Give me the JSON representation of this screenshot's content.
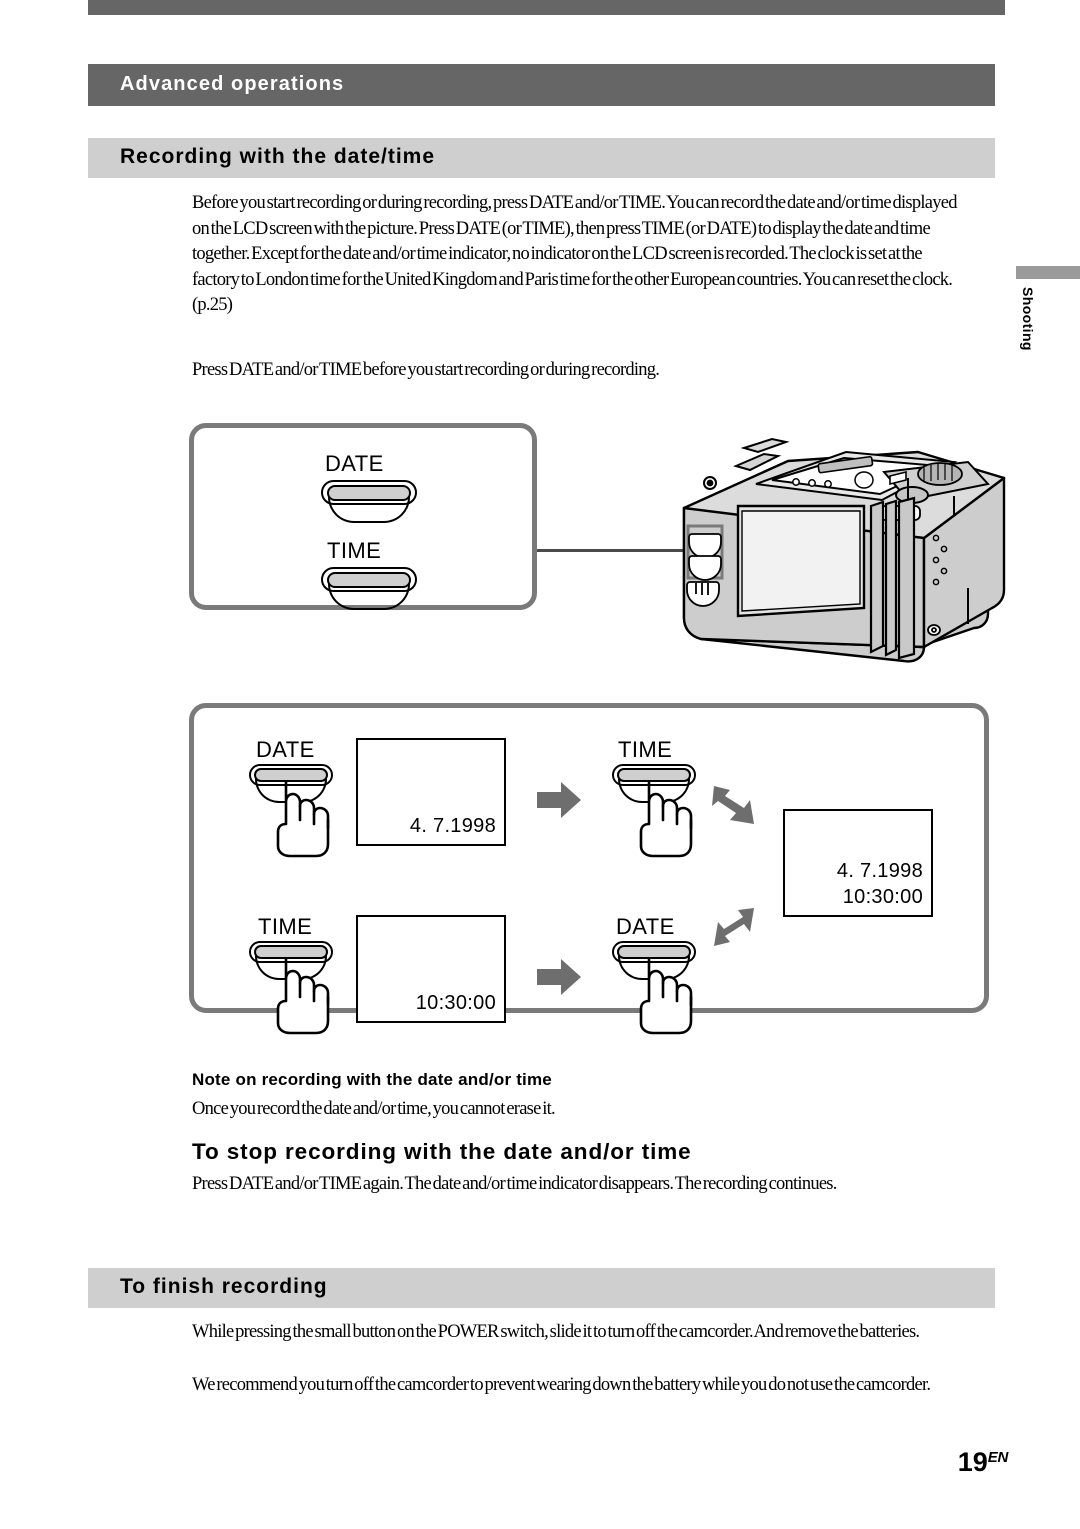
{
  "page": {
    "chapter_title": "Advanced operations",
    "page_number": "19",
    "page_number_suffix": "EN",
    "side_tab_label": "Shooting"
  },
  "sections": {
    "recording_datetime": {
      "heading": "Recording with the date/time",
      "intro": "Before you start recording or during recording, press DATE and/or TIME. You can record the date and/or time displayed on the LCD screen with the picture. Press DATE (or TIME), then press TIME (or DATE) to display the date and time together. Except for the date and/or time indicator, no indicator on the LCD screen is recorded. The clock is set at the factory to London time for the United Kingdom and Paris time for the other European countries. You can reset the clock. (p.25)",
      "press_line": "Press DATE and/or TIME before you start recording or during recording."
    },
    "note": {
      "heading": "Note on recording with the date and/or time",
      "body": "Once you record the date and/or time, you cannot erase it."
    },
    "stop_recording": {
      "heading": "To stop recording with the date and/or time",
      "body": "Press DATE and/or TIME again. The date and/or time indicator disappears. The recording continues."
    },
    "finish_recording": {
      "heading": "To finish recording",
      "body_1": "While pressing the small button on the POWER switch, slide it to turn off the camcorder. And remove the batteries.",
      "body_2": "We recommend you turn off the camcorder to prevent wearing down the battery while you do not use the camcorder."
    }
  },
  "figure_buttons": {
    "caption_date": "DATE",
    "caption_time": "TIME"
  },
  "figure_flow": {
    "row1": {
      "step1_button": "DATE",
      "step1_screen": "4. 7.1998",
      "step2_button": "TIME"
    },
    "row2": {
      "step1_button": "TIME",
      "step1_screen": "10:30:00",
      "step2_button": "DATE"
    },
    "result_screen_line1": "4. 7.1998",
    "result_screen_line2": "10:30:00"
  },
  "colors": {
    "chapter_band": "#666666",
    "section_band": "#cfcfcf",
    "panel_border": "#7a7a7a",
    "arrow_fill": "#6e6e6e",
    "button_face": "#cfcfcf",
    "side_tab_bar": "#9a9a9a"
  }
}
